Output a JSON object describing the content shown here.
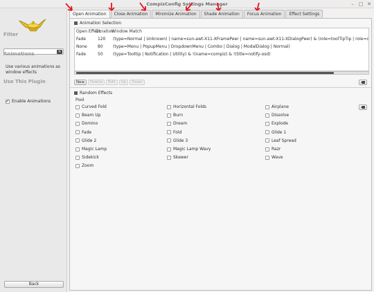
{
  "window": {
    "title": "CompizConfig Settings Manager"
  },
  "sidebar": {
    "filter_heading": "Filter",
    "filter_value": "",
    "animations_heading": "Animations",
    "description": "Use various animations as window effects",
    "use_plugin_heading": "Use This Plugin",
    "enable_label": "Enable Animations",
    "back_label": "Back"
  },
  "tabs": [
    {
      "label": "Open Animation"
    },
    {
      "label": "Close Animation"
    },
    {
      "label": "Minimize Animation"
    },
    {
      "label": "Shade Animation"
    },
    {
      "label": "Focus Animation"
    },
    {
      "label": "Effect Settings"
    }
  ],
  "selection": {
    "title": "Animation Selection",
    "headers": [
      "Open Effect",
      "Duration",
      "Window Match"
    ],
    "rows": [
      {
        "effect": "Fade",
        "duration": "120",
        "match": "(type=Normal | Unknown) | name=sun-awt-X11-XFramePeer | name=sun-awt-X11-XDialogPeer) & (role=toolTipTip | role=qtooltip_label) & !(type=Norm"
      },
      {
        "effect": "None",
        "duration": "80",
        "match": "(type=Menu | PopupMenu | DropdownMenu | Combo | Dialog | ModalDialog | Normal)"
      },
      {
        "effect": "Fade",
        "duration": "50",
        "match": "(type=Tooltip | Notification | Utility) & !(name=compiz) & !(title=notify-osd)"
      }
    ],
    "buttons": {
      "new": "New",
      "delete": "Delete",
      "edit": "Edit",
      "up": "Up",
      "down": "Down"
    }
  },
  "random": {
    "title": "Random Effects",
    "pool_label": "Pool",
    "effects": [
      "Curved Fold",
      "Horizontal Folds",
      "Airplane",
      "Beam Up",
      "Burn",
      "Dissolve",
      "Domino",
      "Dream",
      "Explode",
      "Fade",
      "Fold",
      "Glide 1",
      "Glide 2",
      "Glide 3",
      "Leaf Spread",
      "Magic Lamp",
      "Magic Lamp Wavy",
      "Razr",
      "Sidekick",
      "Skewer",
      "Wave",
      "Zoom"
    ]
  },
  "colors": {
    "annotation_arrow": "#e3141c",
    "accent": "#555555"
  }
}
